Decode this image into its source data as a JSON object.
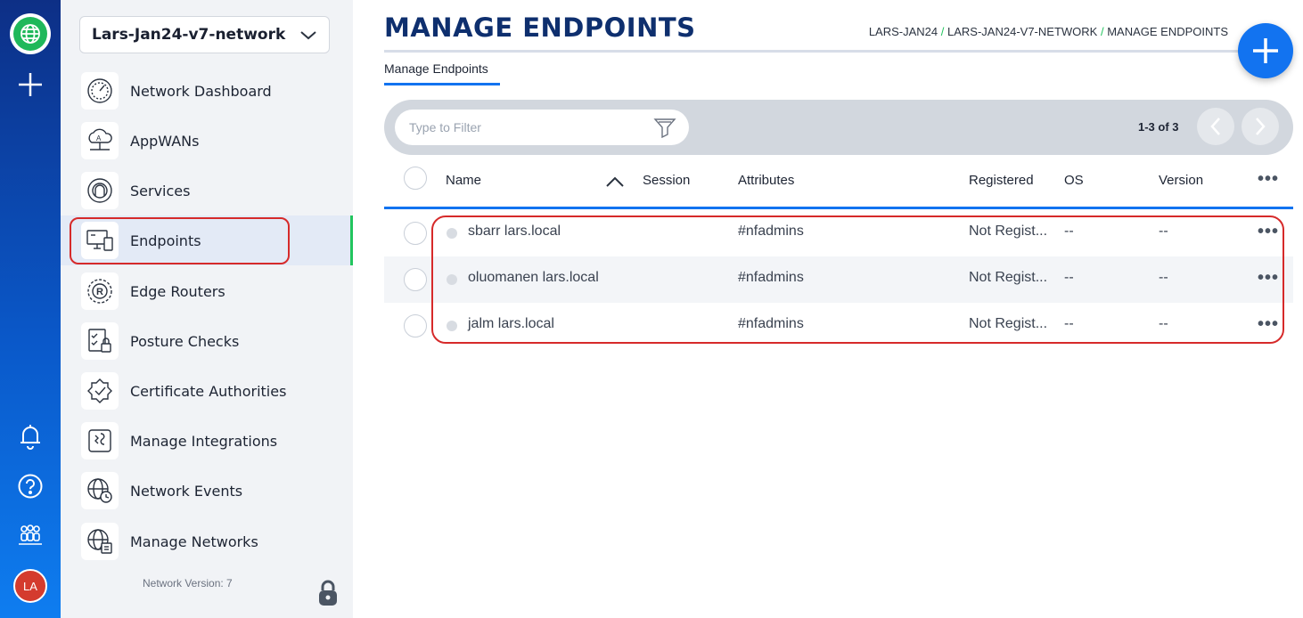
{
  "rail": {
    "avatar_initials": "LA",
    "icons": [
      "globe-icon",
      "plus-icon",
      "bell-icon",
      "help-icon",
      "team-icon"
    ]
  },
  "sidebar": {
    "network_select": "Lars-Jan24-v7-network",
    "items": [
      {
        "label": "Network Dashboard",
        "icon": "dashboard-gauge-icon"
      },
      {
        "label": "AppWANs",
        "icon": "appwan-cloud-icon"
      },
      {
        "label": "Services",
        "icon": "services-icon"
      },
      {
        "label": "Endpoints",
        "icon": "endpoint-devices-icon",
        "active": true
      },
      {
        "label": "Edge Routers",
        "icon": "edge-router-icon"
      },
      {
        "label": "Posture Checks",
        "icon": "posture-check-icon"
      },
      {
        "label": "Certificate Authorities",
        "icon": "certificate-icon"
      },
      {
        "label": "Manage Integrations",
        "icon": "integrations-icon"
      },
      {
        "label": "Network Events",
        "icon": "network-events-icon"
      },
      {
        "label": "Manage Networks",
        "icon": "manage-networks-icon"
      }
    ],
    "network_version": "Network Version: 7"
  },
  "header": {
    "title": "MANAGE ENDPOINTS",
    "breadcrumb": [
      "LARS-JAN24",
      "LARS-JAN24-V7-NETWORK",
      "MANAGE ENDPOINTS"
    ],
    "breadcrumb_sep": "/",
    "tab": "Manage Endpoints"
  },
  "filter": {
    "placeholder": "Type to Filter",
    "paging": "1-3 of 3"
  },
  "table": {
    "columns": [
      "Name",
      "Session",
      "Attributes",
      "Registered",
      "OS",
      "Version"
    ],
    "more": "•••",
    "rows": [
      {
        "name": "sbarr lars.local",
        "attributes": "#nfadmins",
        "registered": "Not Regist...",
        "os": "--",
        "version": "--"
      },
      {
        "name": "oluomanen lars.local",
        "attributes": "#nfadmins",
        "registered": "Not Regist...",
        "os": "--",
        "version": "--"
      },
      {
        "name": "jalm lars.local",
        "attributes": "#nfadmins",
        "registered": "Not Regist...",
        "os": "--",
        "version": "--"
      }
    ]
  },
  "colors": {
    "accent": "#1273f0",
    "title": "#0e2f6e",
    "active_bar": "#22c55e",
    "highlight": "#d62a2a"
  }
}
